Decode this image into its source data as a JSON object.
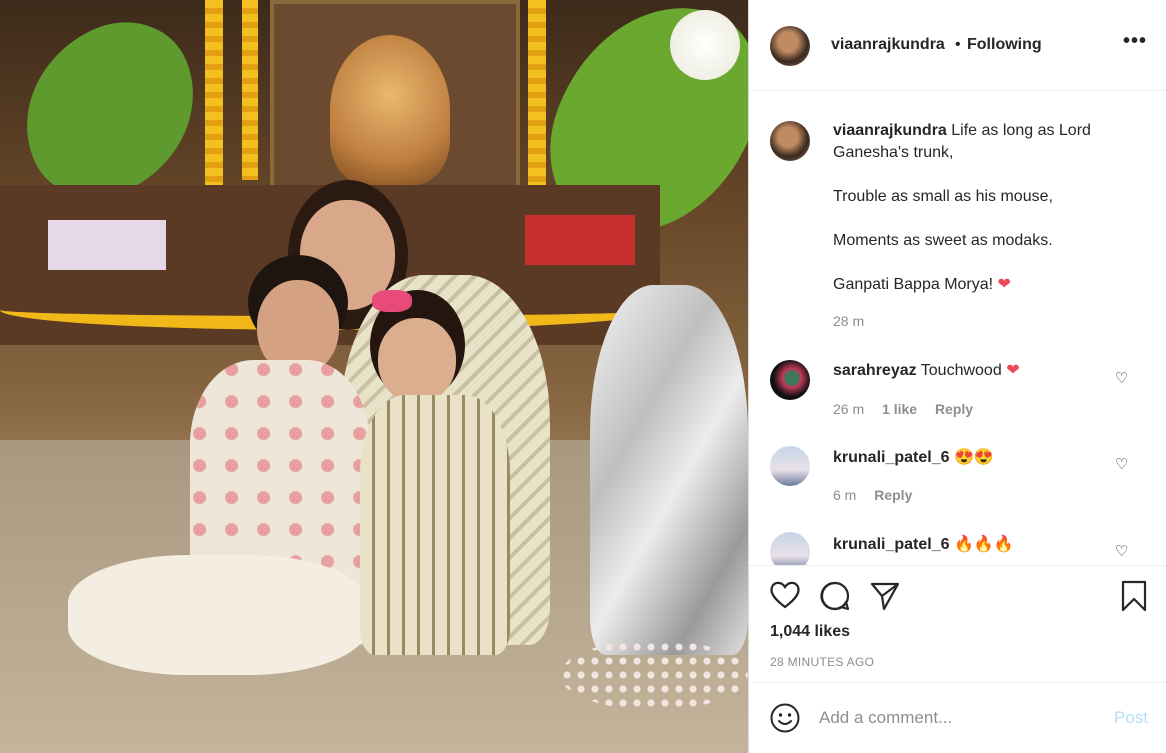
{
  "header": {
    "username": "viaanrajkundra",
    "separator": "•",
    "follow_state": "Following",
    "more_label": "•••"
  },
  "caption": {
    "username": "viaanrajkundra",
    "line1": "Life as long as Lord Ganesha's trunk,",
    "line2": "Trouble as small as his mouse,",
    "line3": "Moments as sweet as modaks.",
    "line4": "Ganpati Bappa Morya!",
    "line4_emoji": "❤",
    "time": "28 m"
  },
  "comments": [
    {
      "username": "sarahreyaz",
      "text": "Touchwood",
      "emoji": "❤",
      "time": "26 m",
      "likes": "1 like",
      "reply": "Reply"
    },
    {
      "username": "krunali_patel_6",
      "text": "",
      "emoji": "😍😍",
      "time": "6 m",
      "likes": "",
      "reply": "Reply"
    },
    {
      "username": "krunali_patel_6",
      "text": "",
      "emoji": "🔥🔥🔥",
      "time": "",
      "likes": "",
      "reply": ""
    }
  ],
  "actions": {
    "likes": "1,044 likes",
    "time_ago": "28 MINUTES AGO"
  },
  "add_comment": {
    "placeholder": "Add a comment...",
    "post_label": "Post"
  },
  "colors": {
    "like_red": "#ed4956",
    "post_disabled": "#b2dffc",
    "muted": "#8e8e8e"
  }
}
